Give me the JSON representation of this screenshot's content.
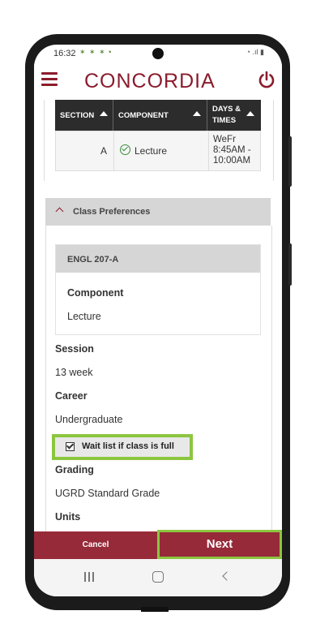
{
  "status_bar": {
    "time": "16:32",
    "left_icons": "✶ ✶ ✶  •",
    "right_icons": "◔ .ıl ▮"
  },
  "header": {
    "brand": "CONCORDIA"
  },
  "section_table": {
    "headers": [
      "SECTION",
      "COMPONENT",
      "DAYS &",
      "TIMES"
    ],
    "row": {
      "section": "A",
      "component": "Lecture",
      "days": "WeFr",
      "time_1": "8:45AM -",
      "time_2": "10:00AM"
    }
  },
  "class_preferences": {
    "header": "Class Preferences",
    "course": {
      "title": "ENGL  207-A",
      "component_label": "Component",
      "component_value": "Lecture"
    },
    "session_label": "Session",
    "session_value": "13 week",
    "career_label": "Career",
    "career_value": "Undergraduate",
    "waitlist_label": "Wait list if class is full",
    "waitlist_checked": true,
    "grading_label": "Grading",
    "grading_value": "UGRD Standard Grade",
    "units_label": "Units"
  },
  "footer": {
    "cancel_label": "Cancel",
    "next_label": "Next"
  },
  "colors": {
    "brand": "#8a1c2c",
    "footer": "#962a39",
    "highlight": "#8cc63f"
  }
}
